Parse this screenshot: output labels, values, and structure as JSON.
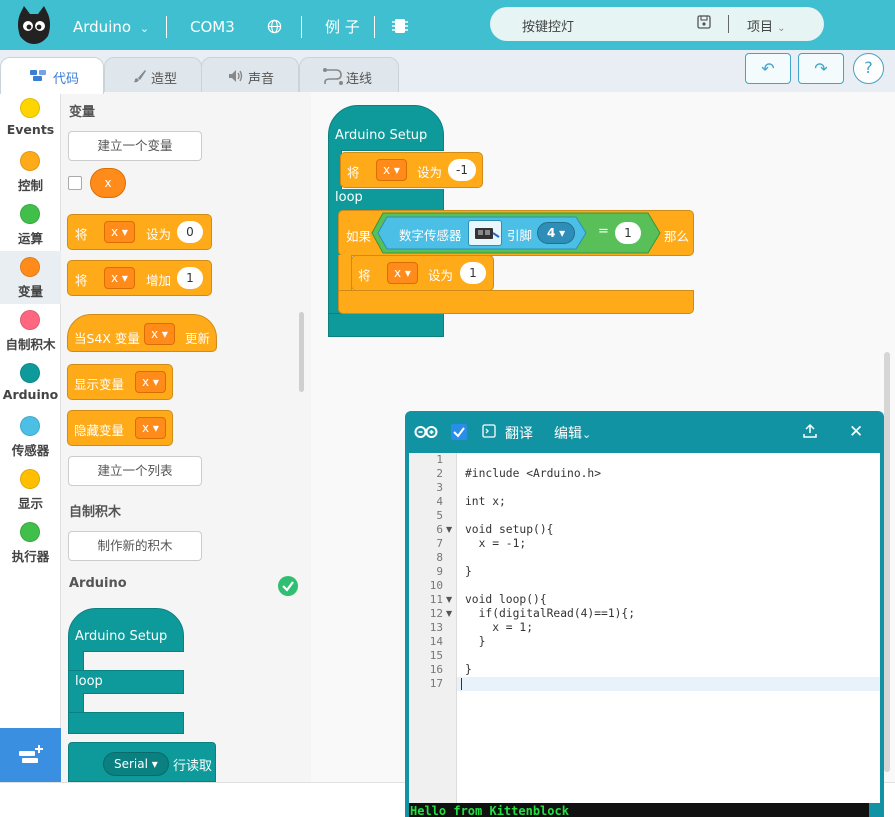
{
  "header": {
    "board": "Arduino",
    "port": "COM3",
    "examples": "例 子",
    "project_name": "按键控灯",
    "project_menu": "项目",
    "colors": {
      "bar": "#3fbfcf"
    }
  },
  "tabs": [
    {
      "label": "代码",
      "icon": "code-icon"
    },
    {
      "label": "造型",
      "icon": "brush-icon"
    },
    {
      "label": "声音",
      "icon": "speaker-icon"
    },
    {
      "label": "连线",
      "icon": "wire-icon"
    }
  ],
  "toolbar": {
    "undo": "↶",
    "redo": "↷",
    "help": "?"
  },
  "categories": [
    {
      "label": "Events",
      "color": "#ffd500"
    },
    {
      "label": "控制",
      "color": "#ffab19"
    },
    {
      "label": "运算",
      "color": "#40bf4a"
    },
    {
      "label": "变量",
      "color": "#ff8c1a"
    },
    {
      "label": "自制积木",
      "color": "#ff6680"
    },
    {
      "label": "Arduino",
      "color": "#0e9a9a"
    },
    {
      "label": "传感器",
      "color": "#4cbfe6"
    },
    {
      "label": "显示",
      "color": "#ffbf00"
    },
    {
      "label": "执行器",
      "color": "#40bf4a"
    }
  ],
  "palette": {
    "variables_title": "变量",
    "make_variable": "建立一个变量",
    "var_name": "x",
    "set_label": "将",
    "set_to": "设为",
    "set_value": "0",
    "change_by": "增加",
    "change_value": "1",
    "when_s4x": "当S4X 变量",
    "update": "更新",
    "show_var": "显示变量",
    "hide_var": "隐藏变量",
    "make_list": "建立一个列表",
    "myblocks_title": "自制积木",
    "make_block": "制作新的积木",
    "arduino_title": "Arduino",
    "arduino_setup": "Arduino Setup",
    "loop": "loop",
    "serial": "Serial",
    "serial_read": "行读取"
  },
  "workspace": {
    "setup_label": "Arduino Setup",
    "set_label": "将",
    "var": "x",
    "set_to": "设为",
    "init_value": "-1",
    "loop_label": "loop",
    "if_label": "如果",
    "digital_sensor": "数字传感器",
    "pin_label": "引脚",
    "pin": "4",
    "equals": "=",
    "compare_value": "1",
    "then_label": "那么",
    "assign_value": "1"
  },
  "code_panel": {
    "translate": "翻译",
    "edit": "编辑",
    "line_numbers": [
      "1",
      "2",
      "3",
      "4",
      "5",
      "6",
      "7",
      "8",
      "9",
      "10",
      "11",
      "12",
      "13",
      "14",
      "15",
      "16",
      "17"
    ],
    "lines": [
      "",
      "#include <Arduino.h>",
      "",
      "int x;",
      "",
      "void setup(){",
      "  x = -1;",
      "",
      "}",
      "",
      "void loop(){",
      "  if(digitalRead(4)==1){;",
      "    x = 1;",
      "  }",
      "",
      "}",
      ""
    ],
    "console_output": "Hello from Kittenblock"
  }
}
